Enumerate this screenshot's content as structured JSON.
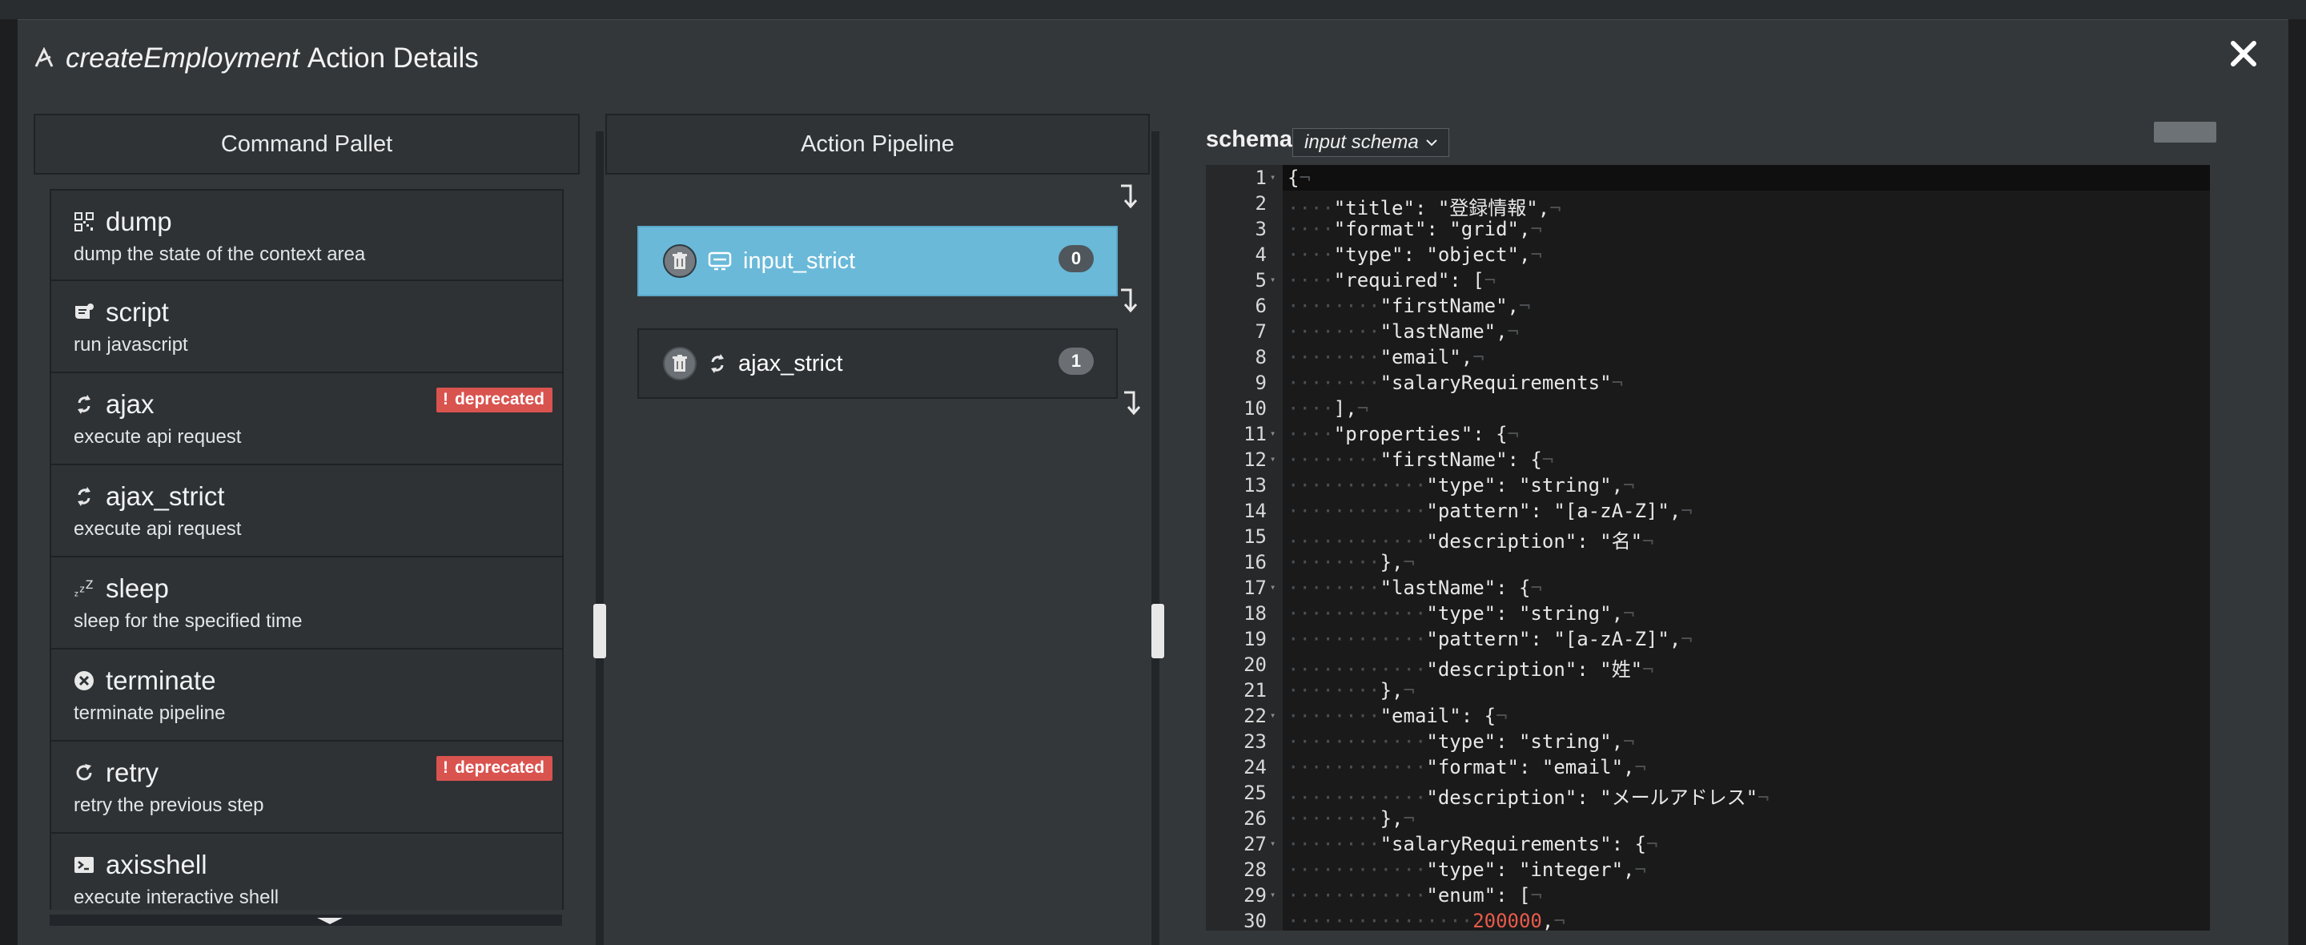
{
  "modal": {
    "title_italic": "createEmployment",
    "title_rest": "Action Details",
    "close_label": "✕"
  },
  "pallet": {
    "header": "Command Pallet",
    "items": [
      {
        "name": "dump",
        "desc": "dump the state of the context area",
        "icon": "qr-icon"
      },
      {
        "name": "script",
        "desc": "run javascript",
        "icon": "script-icon"
      },
      {
        "name": "ajax",
        "desc": "execute api request",
        "icon": "sync-icon",
        "badge": "deprecated"
      },
      {
        "name": "ajax_strict",
        "desc": "execute api request",
        "icon": "sync-icon"
      },
      {
        "name": "sleep",
        "desc": "sleep for the specified time",
        "icon": "sleep-icon"
      },
      {
        "name": "terminate",
        "desc": "terminate pipeline",
        "icon": "times-circle-icon"
      },
      {
        "name": "retry",
        "desc": "retry the previous step",
        "icon": "retry-icon",
        "badge": "deprecated"
      },
      {
        "name": "axisshell",
        "desc": "execute interactive shell",
        "icon": "terminal-icon"
      }
    ]
  },
  "pipeline": {
    "header": "Action Pipeline",
    "steps": [
      {
        "name": "input_strict",
        "index": "0",
        "icon": "input-icon",
        "active": true
      },
      {
        "name": "ajax_strict",
        "index": "1",
        "icon": "sync-icon",
        "active": false
      }
    ]
  },
  "schema": {
    "label": "schema",
    "selected": "input schema",
    "lines": [
      "{",
      "    \"title\": \"登録情報\",",
      "    \"format\": \"grid\",",
      "    \"type\": \"object\",",
      "    \"required\": [",
      "        \"firstName\",",
      "        \"lastName\",",
      "        \"email\",",
      "        \"salaryRequirements\"",
      "    ],",
      "    \"properties\": {",
      "        \"firstName\": {",
      "            \"type\": \"string\",",
      "            \"pattern\": \"[a-zA-Z]\",",
      "            \"description\": \"名\"",
      "        },",
      "        \"lastName\": {",
      "            \"type\": \"string\",",
      "            \"pattern\": \"[a-zA-Z]\",",
      "            \"description\": \"姓\"",
      "        },",
      "        \"email\": {",
      "            \"type\": \"string\",",
      "            \"format\": \"email\",",
      "            \"description\": \"メールアドレス\"",
      "        },",
      "        \"salaryRequirements\": {",
      "            \"type\": \"integer\",",
      "            \"enum\": [",
      "                200000,"
    ],
    "folds": [
      1,
      5,
      11,
      12,
      17,
      22,
      27,
      29
    ],
    "accent_number_color": "#e85b4b"
  }
}
